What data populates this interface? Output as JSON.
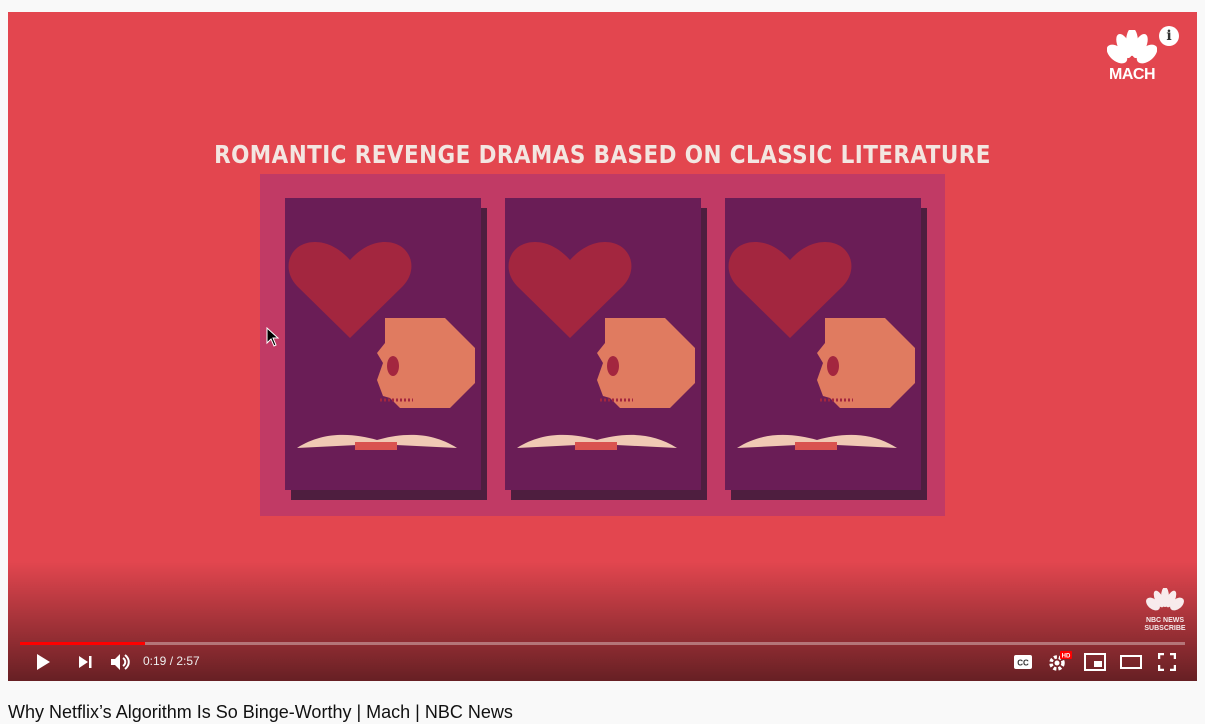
{
  "video": {
    "title": "Why Netflix’s Algorithm Is So Binge-Worthy | Mach | NBC News",
    "scene_title": "ROMANTIC REVENGE DRAMAS BASED ON CLASSIC LITERATURE",
    "cards": [
      {
        "id": "card-1"
      },
      {
        "id": "card-2"
      },
      {
        "id": "card-3"
      }
    ],
    "colors": {
      "background": "#e3464f",
      "board": "#c13a65",
      "card": "#6a1d56",
      "heart": "#a3263f",
      "skull": "#e07b60",
      "book": "#f0c9b4"
    }
  },
  "branding": {
    "logo_text": "MACH",
    "info_icon": "i",
    "watermark": [
      "NBC NEWS",
      "SUBSCRIBE"
    ]
  },
  "player": {
    "current_time": "0:19",
    "separator": " / ",
    "duration": "2:57",
    "progress_fraction": 0.107,
    "quality_badge": "HD",
    "cc_label": "CC",
    "icons": [
      "play-icon",
      "next-icon",
      "volume-icon",
      "captions-icon",
      "settings-icon",
      "miniplayer-icon",
      "theater-icon",
      "fullscreen-icon"
    ]
  }
}
